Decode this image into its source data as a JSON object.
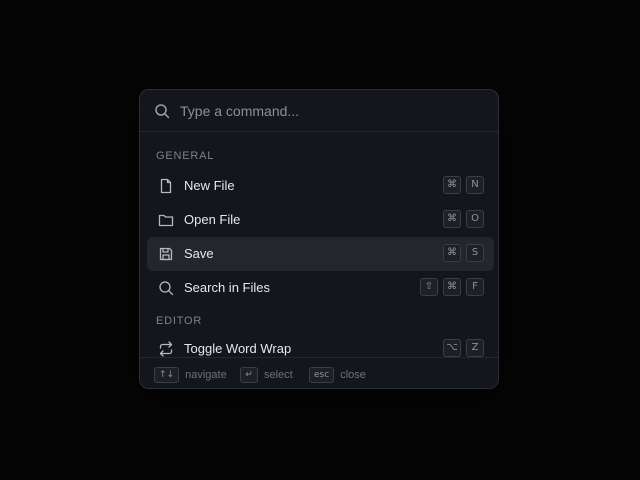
{
  "search": {
    "placeholder": "Type a command...",
    "icon": "search-icon"
  },
  "sections": [
    {
      "label": "GENERAL",
      "items": [
        {
          "label": "New File",
          "icon": "file-icon",
          "keys": [
            "⌘",
            "N"
          ],
          "selected": false
        },
        {
          "label": "Open File",
          "icon": "folder-icon",
          "keys": [
            "⌘",
            "O"
          ],
          "selected": false
        },
        {
          "label": "Save",
          "icon": "save-icon",
          "keys": [
            "⌘",
            "S"
          ],
          "selected": true
        },
        {
          "label": "Search in Files",
          "icon": "search-icon",
          "keys": [
            "⇧",
            "⌘",
            "F"
          ],
          "selected": false
        }
      ]
    },
    {
      "label": "EDITOR",
      "items": [
        {
          "label": "Toggle Word Wrap",
          "icon": "repeat-icon",
          "keys": [
            "⌥",
            "Z"
          ],
          "selected": false
        }
      ]
    }
  ],
  "footer": {
    "navigate": {
      "key": "↑↓",
      "label": "navigate"
    },
    "select": {
      "key": "↵",
      "label": "select"
    },
    "close": {
      "key": "esc",
      "label": "close"
    }
  },
  "colors": {
    "background": "#050505",
    "panel": "#13161b",
    "selected": "#23262c",
    "text": "#e6e8eb",
    "muted": "#7d838c"
  }
}
